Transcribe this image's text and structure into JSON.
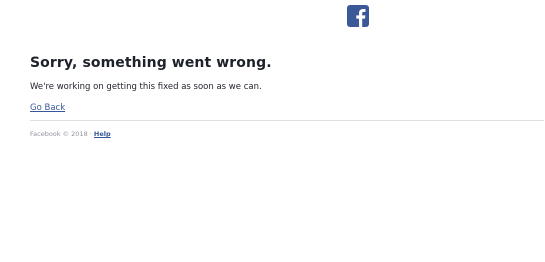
{
  "brand": {
    "logo_icon": "facebook-f-icon",
    "brand_color": "#3b5998"
  },
  "error": {
    "title": "Sorry, something went wrong.",
    "message": "We're working on getting this fixed as soon as we can.",
    "back_link": "Go Back"
  },
  "footer": {
    "copyright": "Facebook © 2018",
    "separator": " · ",
    "help_link": "Help"
  }
}
